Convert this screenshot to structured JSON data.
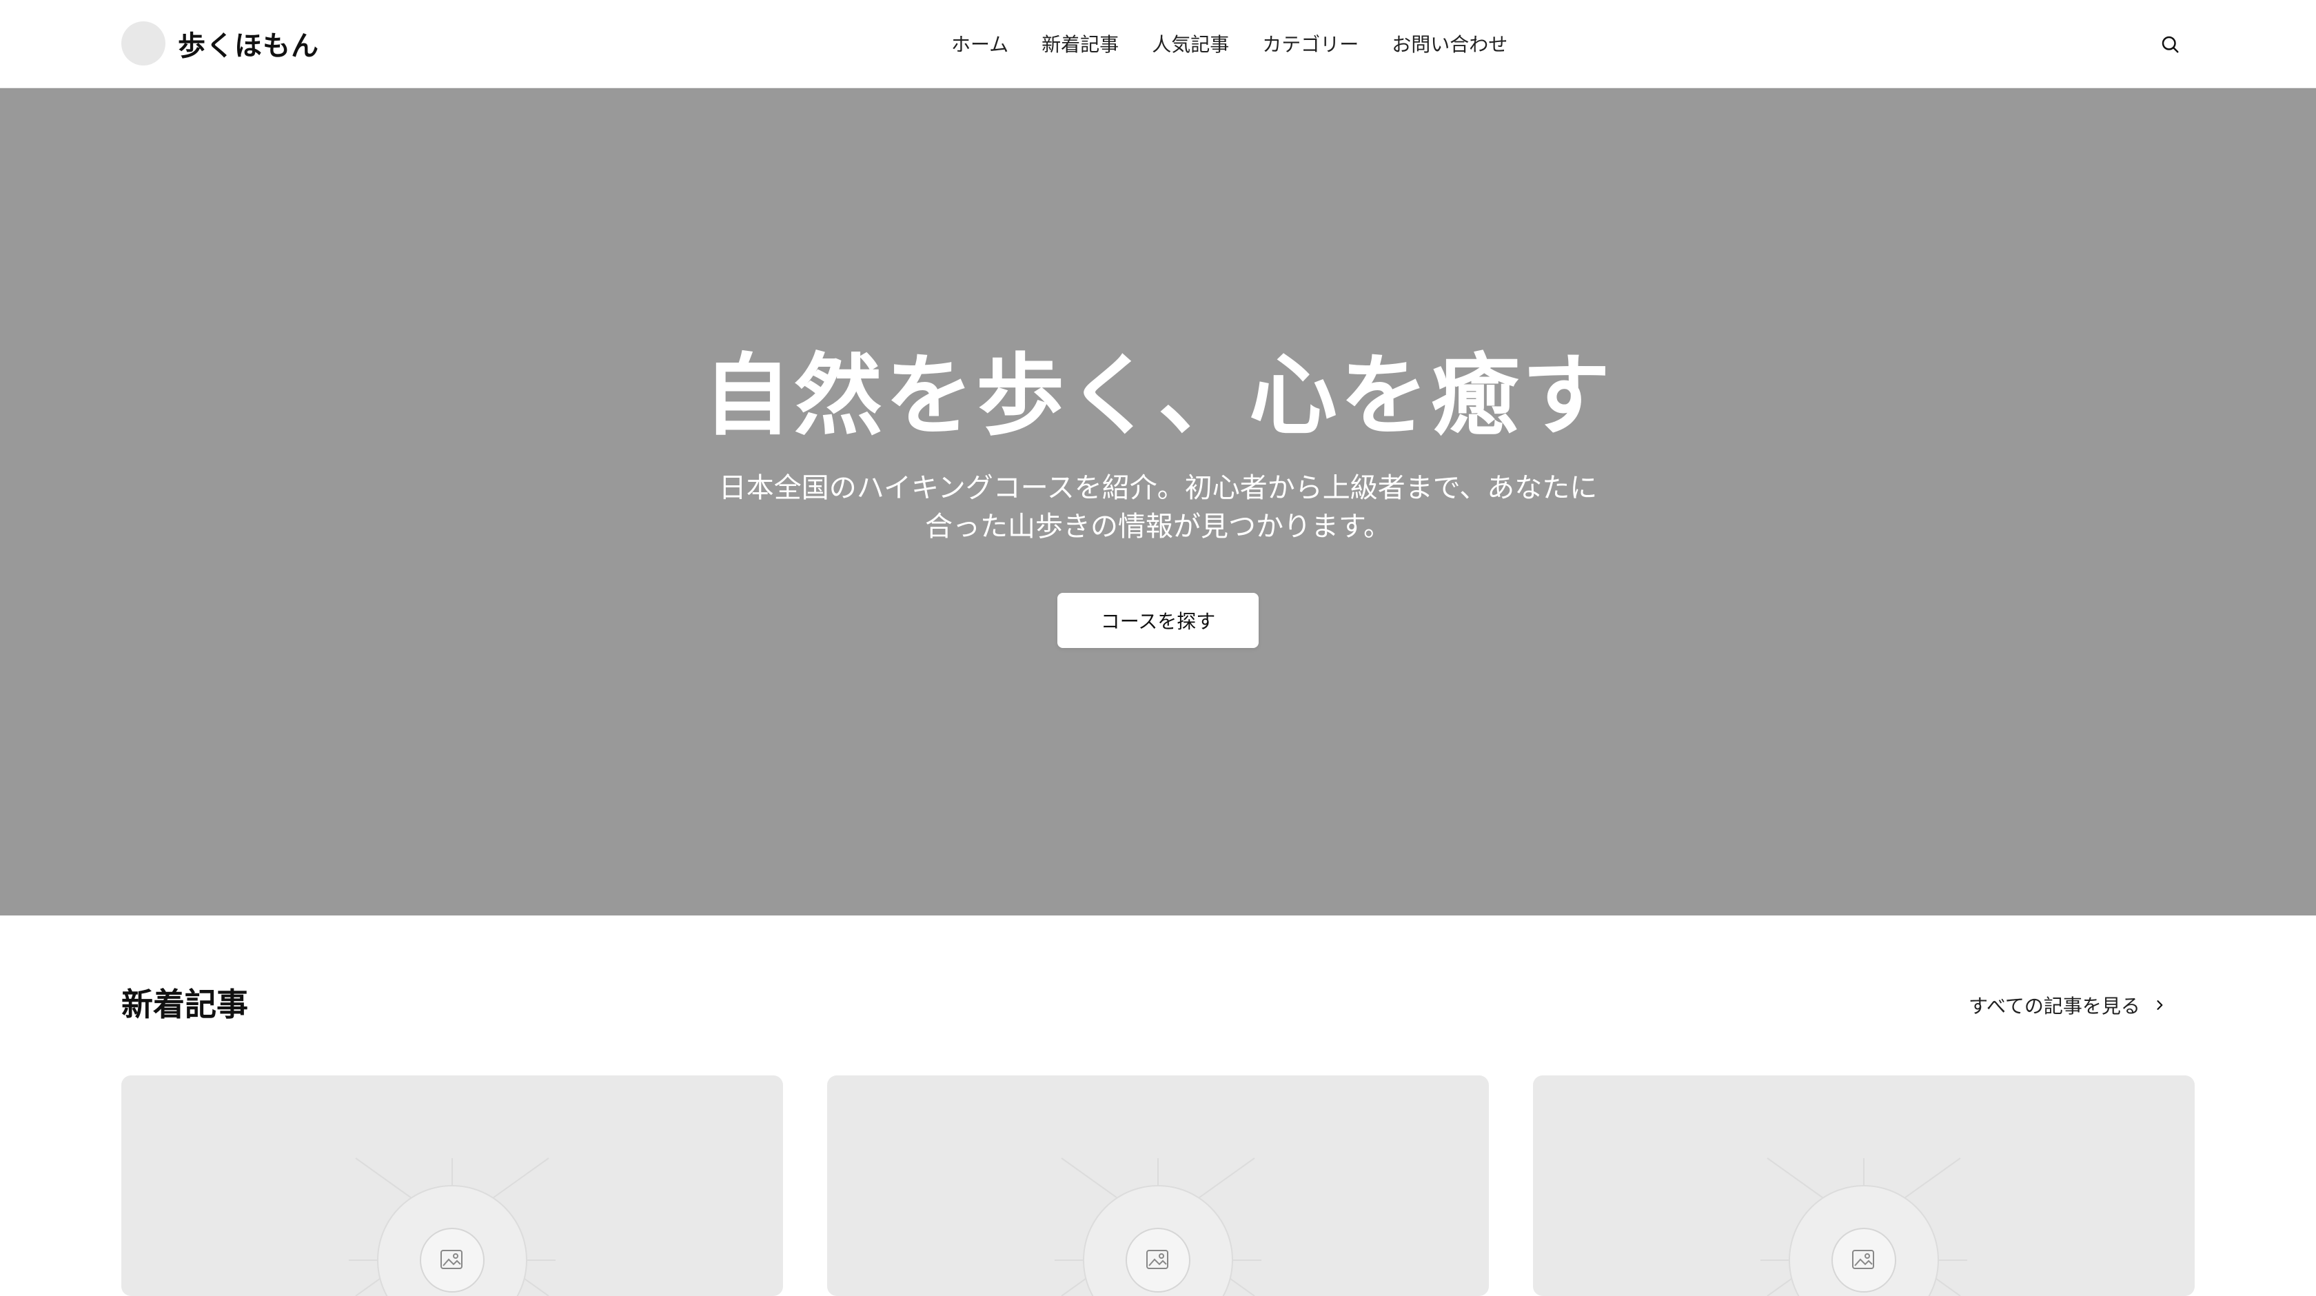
{
  "header": {
    "logo_text": "歩くほもん",
    "nav": [
      {
        "label": "ホーム"
      },
      {
        "label": "新着記事"
      },
      {
        "label": "人気記事"
      },
      {
        "label": "カテゴリー"
      },
      {
        "label": "お問い合わせ"
      }
    ],
    "search_icon": "search-icon"
  },
  "hero": {
    "title": "自然を歩く、心を癒す",
    "subtitle_line1": "日本全国のハイキングコースを紹介。初心者から上級者まで、あなたに",
    "subtitle_line2": "合った山歩きの情報が見つかります。",
    "button_label": "コースを探す"
  },
  "section": {
    "title": "新着記事",
    "view_all_label": "すべての記事を見る",
    "view_all_icon": "chevron-right-icon"
  },
  "cards": [
    {
      "image_icon": "image-placeholder-icon"
    },
    {
      "image_icon": "image-placeholder-icon"
    },
    {
      "image_icon": "image-placeholder-icon"
    }
  ],
  "colors": {
    "hero_background": "#999999",
    "card_placeholder": "#e9e9e9",
    "logo_mark": "#e8e8e8"
  }
}
